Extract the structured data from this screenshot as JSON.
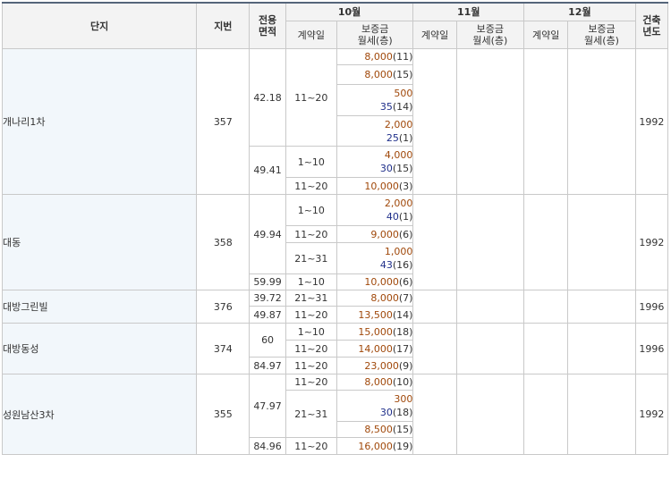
{
  "header": {
    "complex": "단지",
    "lot": "지번",
    "area": "전용\n면적",
    "built_year": "건축\n년도",
    "months": [
      "10월",
      "11월",
      "12월"
    ],
    "contract_date": "계약일",
    "deposit_rent": "보증금\n월세(층)"
  },
  "groups": [
    {
      "name": "개나리1차",
      "lot": "357",
      "built": "1992",
      "areas": [
        {
          "area": "42.18",
          "dates": [
            {
              "date": "11~20",
              "items": [
                {
                  "deposit": "8,000",
                  "rent": "",
                  "floor": "(11)"
                },
                {
                  "deposit": "8,000",
                  "rent": "",
                  "floor": "(15)"
                },
                {
                  "deposit": "500",
                  "rent": "35",
                  "floor": "(14)"
                },
                {
                  "deposit": "2,000",
                  "rent": "25",
                  "floor": "(1)"
                }
              ]
            }
          ]
        },
        {
          "area": "49.41",
          "dates": [
            {
              "date": "1~10",
              "items": [
                {
                  "deposit": "4,000",
                  "rent": "30",
                  "floor": "(15)"
                }
              ]
            },
            {
              "date": "11~20",
              "items": [
                {
                  "deposit": "10,000",
                  "rent": "",
                  "floor": "(3)"
                }
              ]
            }
          ]
        }
      ]
    },
    {
      "name": "대동",
      "lot": "358",
      "built": "1992",
      "areas": [
        {
          "area": "49.94",
          "dates": [
            {
              "date": "1~10",
              "items": [
                {
                  "deposit": "2,000",
                  "rent": "40",
                  "floor": "(1)"
                }
              ]
            },
            {
              "date": "11~20",
              "items": [
                {
                  "deposit": "9,000",
                  "rent": "",
                  "floor": "(6)"
                }
              ]
            },
            {
              "date": "21~31",
              "items": [
                {
                  "deposit": "1,000",
                  "rent": "43",
                  "floor": "(16)"
                }
              ]
            }
          ]
        },
        {
          "area": "59.99",
          "dates": [
            {
              "date": "1~10",
              "items": [
                {
                  "deposit": "10,000",
                  "rent": "",
                  "floor": "(6)"
                }
              ]
            }
          ]
        }
      ]
    },
    {
      "name": "대방그린빌",
      "lot": "376",
      "built": "1996",
      "areas": [
        {
          "area": "39.72",
          "dates": [
            {
              "date": "21~31",
              "items": [
                {
                  "deposit": "8,000",
                  "rent": "",
                  "floor": "(7)"
                }
              ]
            }
          ]
        },
        {
          "area": "49.87",
          "dates": [
            {
              "date": "11~20",
              "items": [
                {
                  "deposit": "13,500",
                  "rent": "",
                  "floor": "(14)"
                }
              ]
            }
          ]
        }
      ]
    },
    {
      "name": "대방동성",
      "lot": "374",
      "built": "1996",
      "areas": [
        {
          "area": "60",
          "dates": [
            {
              "date": "1~10",
              "items": [
                {
                  "deposit": "15,000",
                  "rent": "",
                  "floor": "(18)"
                }
              ]
            },
            {
              "date": "11~20",
              "items": [
                {
                  "deposit": "14,000",
                  "rent": "",
                  "floor": "(17)"
                }
              ]
            }
          ]
        },
        {
          "area": "84.97",
          "dates": [
            {
              "date": "11~20",
              "items": [
                {
                  "deposit": "23,000",
                  "rent": "",
                  "floor": "(9)"
                }
              ]
            }
          ]
        }
      ]
    },
    {
      "name": "성원남산3차",
      "lot": "355",
      "built": "1992",
      "areas": [
        {
          "area": "47.97",
          "dates": [
            {
              "date": "11~20",
              "items": [
                {
                  "deposit": "8,000",
                  "rent": "",
                  "floor": "(10)"
                }
              ]
            },
            {
              "date": "21~31",
              "items": [
                {
                  "deposit": "300",
                  "rent": "30",
                  "floor": "(18)"
                },
                {
                  "deposit": "8,500",
                  "rent": "",
                  "floor": "(15)"
                }
              ]
            }
          ]
        },
        {
          "area": "84.96",
          "dates": [
            {
              "date": "11~20",
              "items": [
                {
                  "deposit": "16,000",
                  "rent": "",
                  "floor": "(19)"
                }
              ]
            }
          ]
        }
      ]
    }
  ]
}
